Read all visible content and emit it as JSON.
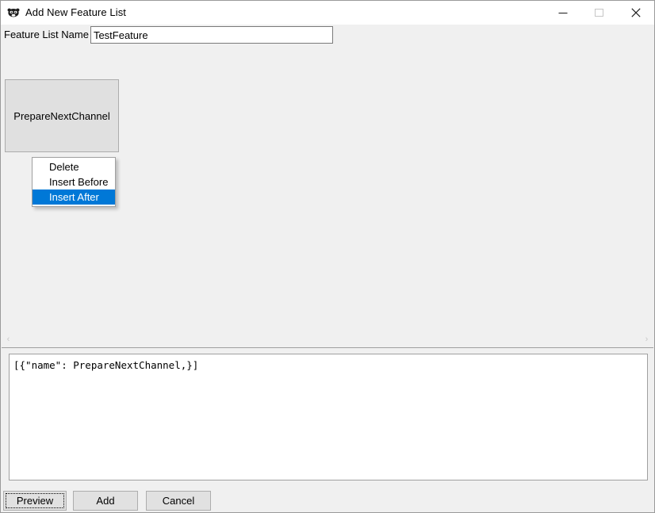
{
  "window": {
    "title": "Add New Feature List",
    "icon": "app-mask-icon",
    "controls": {
      "minimize": "minimize-icon",
      "maximize": "maximize-icon",
      "close": "close-icon"
    }
  },
  "form": {
    "name_label": "Feature List Name",
    "name_value": "TestFeature",
    "name_placeholder": ""
  },
  "canvas": {
    "nodes": [
      {
        "label": "PrepareNextChannel"
      }
    ],
    "scrollbar": {
      "left_arrow": "‹",
      "right_arrow": "›"
    }
  },
  "context_menu": {
    "items": [
      {
        "label": "Delete",
        "selected": false
      },
      {
        "label": "Insert Before",
        "selected": false
      },
      {
        "label": "Insert After",
        "selected": true
      }
    ],
    "highlight_color": "#0078d7"
  },
  "preview": {
    "text": "[{\"name\": PrepareNextChannel,}]"
  },
  "footer": {
    "preview_label": "Preview",
    "add_label": "Add",
    "cancel_label": "Cancel"
  }
}
